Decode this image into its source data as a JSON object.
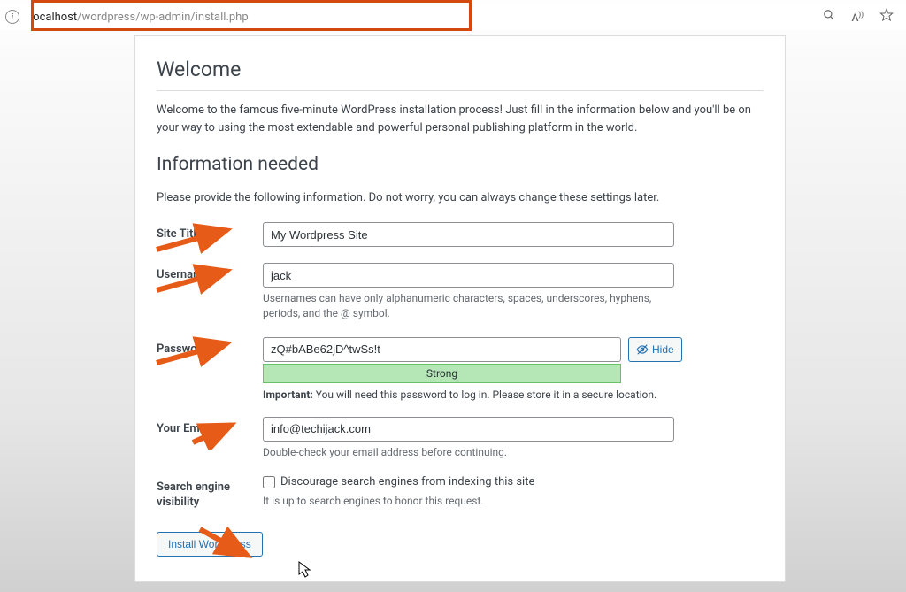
{
  "browser": {
    "url_host": "localhost",
    "url_path": "/wordpress/wp-admin/install.php"
  },
  "headings": {
    "welcome": "Welcome",
    "info_needed": "Information needed"
  },
  "paragraphs": {
    "intro": "Welcome to the famous five-minute WordPress installation process! Just fill in the information below and you'll be on your way to using the most extendable and powerful personal publishing platform in the world.",
    "subintro": "Please provide the following information. Do not worry, you can always change these settings later."
  },
  "fields": {
    "site_title": {
      "label": "Site Title",
      "value": "My Wordpress Site"
    },
    "username": {
      "label": "Username",
      "value": "jack",
      "hint": "Usernames can have only alphanumeric characters, spaces, underscores, hyphens, periods, and the @ symbol."
    },
    "password": {
      "label": "Password",
      "value": "zQ#bABe62jD^twSs!t",
      "hide_label": "Hide",
      "strength": "Strong",
      "important_label": "Important:",
      "important_text": " You will need this password to log in. Please store it in a secure location."
    },
    "email": {
      "label": "Your Email",
      "value": "info@techijack.com",
      "hint": "Double-check your email address before continuing."
    },
    "visibility": {
      "label": "Search engine visibility",
      "checkbox_label": "Discourage search engines from indexing this site",
      "hint": "It is up to search engines to honor this request."
    }
  },
  "buttons": {
    "install": "Install WordPress"
  }
}
